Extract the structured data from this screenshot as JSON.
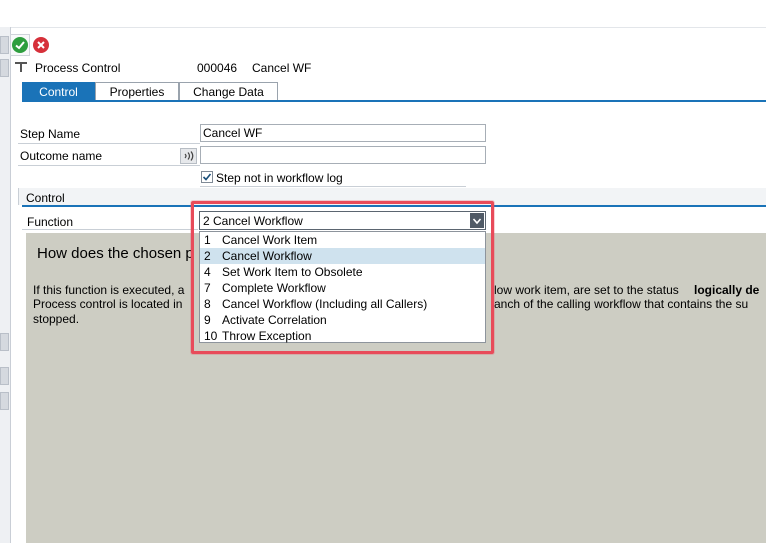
{
  "header": {
    "title": "Process Control",
    "step_id": "000046",
    "step_title": "Cancel WF"
  },
  "tabs": [
    "Control",
    "Properties",
    "Change Data"
  ],
  "form": {
    "step_name_label": "Step Name",
    "step_name_value": "Cancel WF",
    "outcome_label": "Outcome name",
    "outcome_value": "",
    "not_in_log_label": "Step not in workflow log",
    "not_in_log_checked": true
  },
  "control": {
    "section_label": "Control",
    "function_label": "Function",
    "selected": "2 Cancel Workflow",
    "options": [
      {
        "num": "1",
        "text": "Cancel Work Item"
      },
      {
        "num": "2",
        "text": "Cancel Workflow"
      },
      {
        "num": "4",
        "text": "Set Work Item to Obsolete"
      },
      {
        "num": "7",
        "text": "Complete Workflow"
      },
      {
        "num": "8",
        "text": "Cancel Workflow (Including all Callers)"
      },
      {
        "num": "9",
        "text": "Activate Correlation"
      },
      {
        "num": "10",
        "text": "Throw Exception"
      }
    ],
    "selected_index": 1
  },
  "help": {
    "heading": "How does the chosen p",
    "line1_a": "If this function is executed, a",
    "line1_b": "low work item, are set to the status",
    "line1_bold": "logically de",
    "line2_a": "Process control is located in",
    "line2_b": "anch of the calling workflow that contains the su",
    "line3": "stopped."
  },
  "colors": {
    "accent": "#1a73b8",
    "highlight": "#e84b5a",
    "help_bg": "#cdcdc3"
  }
}
